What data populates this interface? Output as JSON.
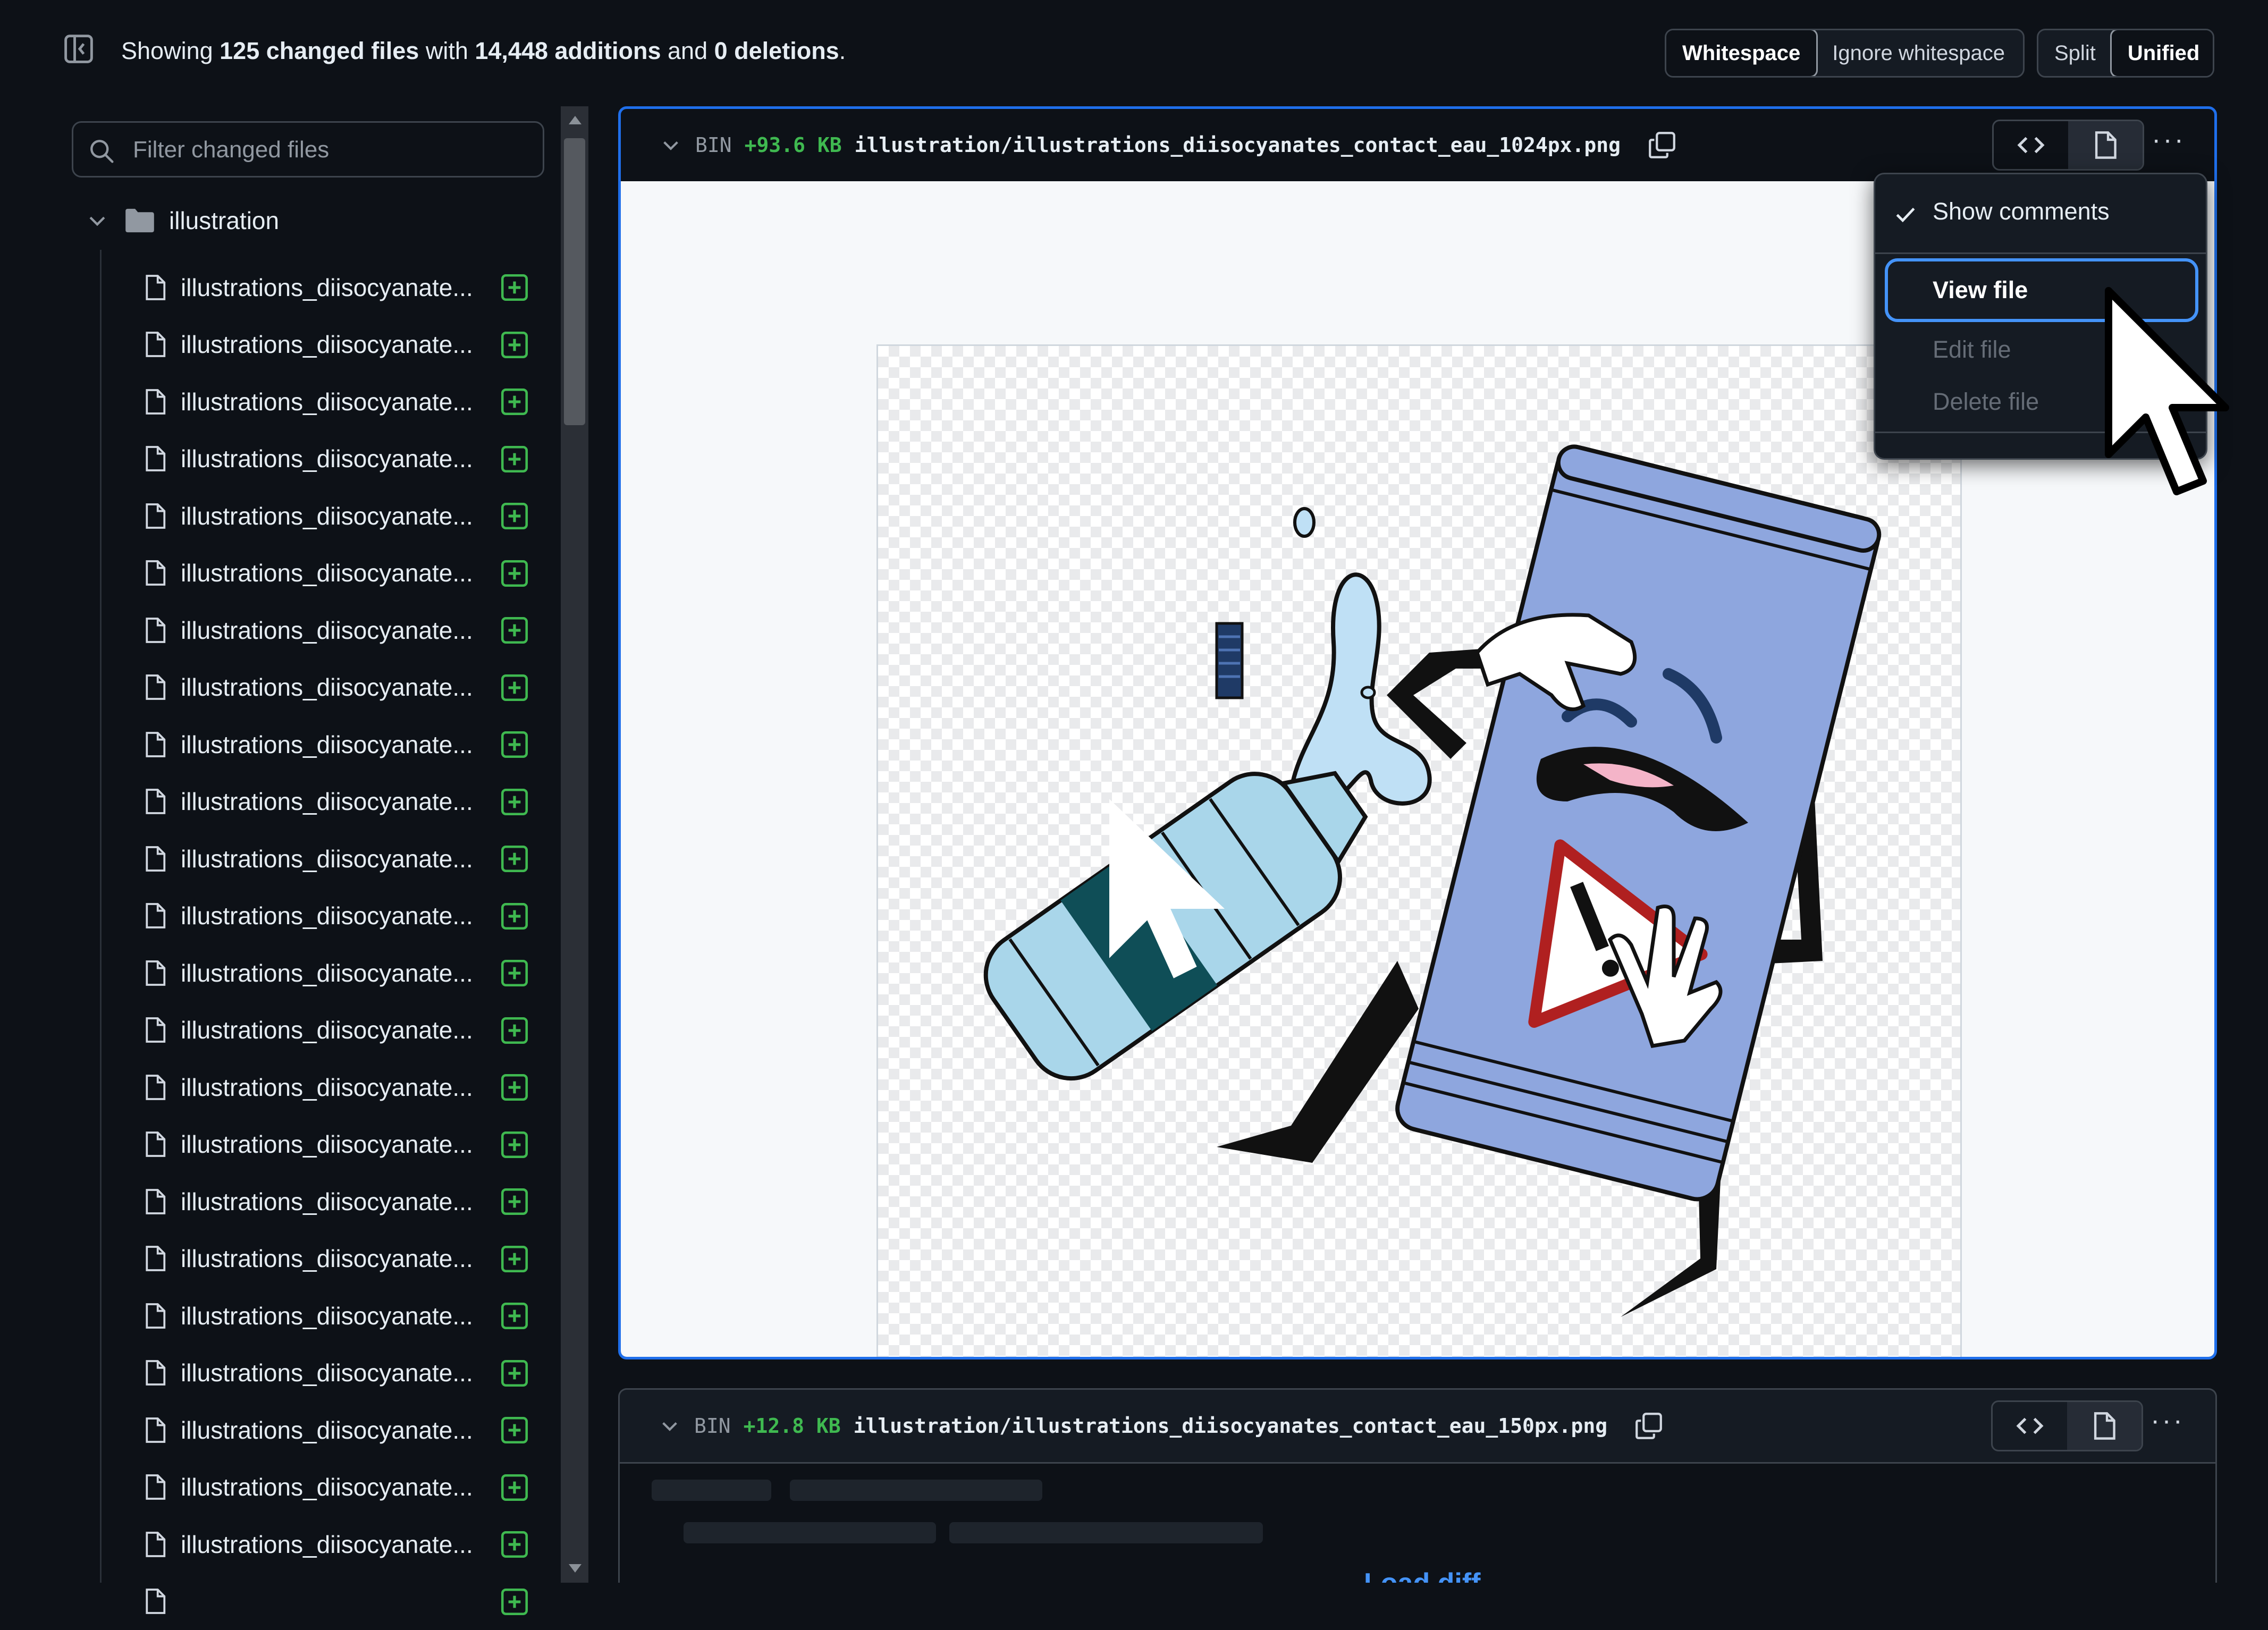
{
  "summary": {
    "prefix": "Showing",
    "changed_files": "125 changed files",
    "with": "with",
    "additions": "14,448 additions",
    "and": "and",
    "deletions": "0 deletions",
    "suffix": "."
  },
  "toolbar": {
    "whitespace_label": "Whitespace",
    "ignore_whitespace_label": "Ignore whitespace",
    "split_label": "Split",
    "unified_label": "Unified",
    "active_whitespace": "Whitespace",
    "active_view": "Unified"
  },
  "file_filter": {
    "placeholder": "Filter changed files"
  },
  "tree": {
    "folder_name": "illustration",
    "files": [
      {
        "name": "illustrations_diisocyanate...",
        "status": "added"
      },
      {
        "name": "illustrations_diisocyanate...",
        "status": "added"
      },
      {
        "name": "illustrations_diisocyanate...",
        "status": "added"
      },
      {
        "name": "illustrations_diisocyanate...",
        "status": "added"
      },
      {
        "name": "illustrations_diisocyanate...",
        "status": "added"
      },
      {
        "name": "illustrations_diisocyanate...",
        "status": "added"
      },
      {
        "name": "illustrations_diisocyanate...",
        "status": "added"
      },
      {
        "name": "illustrations_diisocyanate...",
        "status": "added"
      },
      {
        "name": "illustrations_diisocyanate...",
        "status": "added"
      },
      {
        "name": "illustrations_diisocyanate...",
        "status": "added"
      },
      {
        "name": "illustrations_diisocyanate...",
        "status": "added"
      },
      {
        "name": "illustrations_diisocyanate...",
        "status": "added"
      },
      {
        "name": "illustrations_diisocyanate...",
        "status": "added"
      },
      {
        "name": "illustrations_diisocyanate...",
        "status": "added"
      },
      {
        "name": "illustrations_diisocyanate...",
        "status": "added"
      },
      {
        "name": "illustrations_diisocyanate...",
        "status": "added"
      },
      {
        "name": "illustrations_diisocyanate...",
        "status": "added"
      },
      {
        "name": "illustrations_diisocyanate...",
        "status": "added"
      },
      {
        "name": "illustrations_diisocyanate...",
        "status": "added"
      },
      {
        "name": "illustrations_diisocyanate...",
        "status": "added"
      },
      {
        "name": "illustrations_diisocyanate...",
        "status": "added"
      },
      {
        "name": "illustrations_diisocyanate...",
        "status": "added"
      },
      {
        "name": "illustrations_diisocyanate...",
        "status": "added"
      },
      {
        "name": "",
        "status": "added"
      }
    ]
  },
  "diffs": [
    {
      "type": "BIN",
      "size": "+93.6 KB",
      "path": "illustration/illustrations_diisocyanates_contact_eau_1024px.png"
    },
    {
      "type": "BIN",
      "size": "+12.8 KB",
      "path": "illustration/illustrations_diisocyanates_contact_eau_150px.png",
      "partial_link": "Load diff"
    }
  ],
  "dropdown": {
    "show_comments": "Show comments",
    "show_comments_checked": true,
    "view_file": "View file",
    "edit_file": "Edit file",
    "delete_file": "Delete file"
  },
  "icons": {
    "sidebar_toggle": "sidebar-collapse-icon",
    "search": "search-icon",
    "chevron": "chevron-down-icon",
    "folder": "folder-icon",
    "file": "file-icon",
    "added": "diff-added-icon",
    "copy": "copy-icon",
    "code": "code-icon",
    "rich": "file-icon",
    "kebab": "kebab-horizontal-icon",
    "check": "check-icon",
    "cursor": "mouse-pointer-icon"
  },
  "colors": {
    "background": "#0d1117",
    "accent": "#1f6feb",
    "added": "#3fb950",
    "muted": "#9198a1"
  }
}
